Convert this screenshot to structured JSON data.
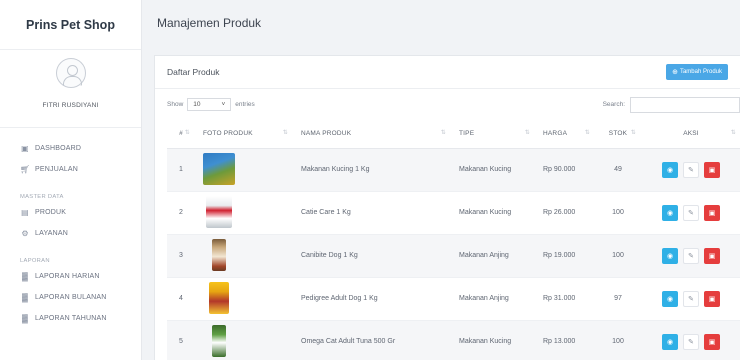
{
  "sidebar": {
    "brand": "Prins Pet Shop",
    "user_name": "FITRI RUSDIYANI",
    "items": [
      {
        "label": "DASHBOARD",
        "icon": "dashboard-icon"
      },
      {
        "label": "PENJUALAN",
        "icon": "cart-icon"
      }
    ],
    "section_master": "MASTER DATA",
    "master_items": [
      {
        "label": "PRODUK",
        "icon": "box-icon"
      },
      {
        "label": "LAYANAN",
        "icon": "gear-icon"
      }
    ],
    "section_laporan": "LAPORAN",
    "laporan_items": [
      {
        "label": "LAPORAN HARIAN",
        "icon": "bar-chart-icon"
      },
      {
        "label": "LAPORAN BULANAN",
        "icon": "bar-chart-icon"
      },
      {
        "label": "LAPORAN TAHUNAN",
        "icon": "bar-chart-icon"
      }
    ]
  },
  "header": {
    "title": "Manajemen Produk"
  },
  "card": {
    "title": "Daftar Produk",
    "add_button": "Tambah Produk",
    "show_label": "Show",
    "entries_value": "10",
    "entries_label": "entries",
    "search_label": "Search:"
  },
  "table": {
    "columns": [
      "#",
      "FOTO PRODUK",
      "NAMA PRODUK",
      "TIPE",
      "HARGA",
      "STOK",
      "AKSI"
    ],
    "rows": [
      {
        "no": "1",
        "nama": "Makanan Kucing 1 Kg",
        "tipe": "Makanan Kucing",
        "harga": "Rp 90.000",
        "stok": "49"
      },
      {
        "no": "2",
        "nama": "Catie Care 1 Kg",
        "tipe": "Makanan Kucing",
        "harga": "Rp 26.000",
        "stok": "100"
      },
      {
        "no": "3",
        "nama": "Canibite Dog 1 Kg",
        "tipe": "Makanan Anjing",
        "harga": "Rp 19.000",
        "stok": "100"
      },
      {
        "no": "4",
        "nama": "Pedigree Adult Dog 1 Kg",
        "tipe": "Makanan Anjing",
        "harga": "Rp 31.000",
        "stok": "97"
      },
      {
        "no": "5",
        "nama": "Omega Cat Adult Tuna 500 Gr",
        "tipe": "Makanan Kucing",
        "harga": "Rp 13.000",
        "stok": "100"
      }
    ]
  },
  "colors": {
    "primary": "#4aa7e6",
    "info": "#2fb0e6",
    "danger": "#e53d3d"
  }
}
